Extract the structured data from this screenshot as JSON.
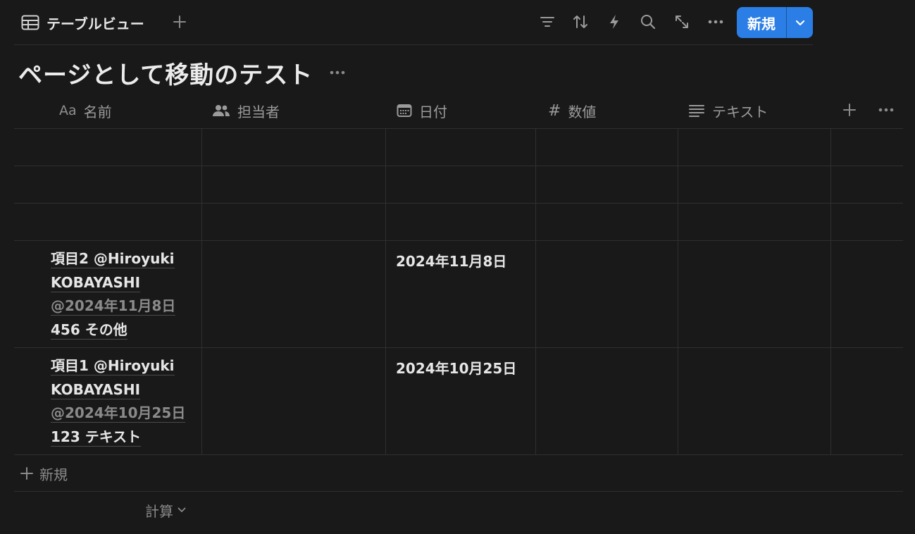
{
  "toolbar": {
    "view_tab_label": "テーブルビュー",
    "new_button_label": "新規",
    "tools": [
      "filter-icon",
      "sort-icon",
      "automation-bolt-icon",
      "search-icon",
      "expand-icon",
      "more-icon"
    ]
  },
  "page": {
    "title": "ページとして移動のテスト"
  },
  "table": {
    "columns": [
      {
        "label": "名前",
        "icon": "Aa"
      },
      {
        "label": "担当者",
        "icon": "people-icon"
      },
      {
        "label": "日付",
        "icon": "calendar-icon"
      },
      {
        "label": "数値",
        "icon": "#"
      },
      {
        "label": "テキスト",
        "icon": "text-lines-icon"
      }
    ],
    "rows": [
      {
        "name": "",
        "date": ""
      },
      {
        "name": "",
        "date": ""
      },
      {
        "name": "",
        "date": ""
      },
      {
        "name_lines": [
          "項目2 @Hiroyuki",
          "KOBAYASHI",
          "@2024年11月8日",
          "456 その他"
        ],
        "date": "2024年11月8日"
      },
      {
        "name_lines": [
          "項目1 @Hiroyuki",
          "KOBAYASHI",
          "@2024年10月25日",
          "123 テキスト"
        ],
        "date": "2024年10月25日"
      }
    ]
  },
  "footer": {
    "add_row_label": "新規",
    "calculate_label": "計算"
  },
  "colors": {
    "background": "#191919",
    "accent": "#2b7ee6",
    "grid_line": "#2f2f2f"
  }
}
